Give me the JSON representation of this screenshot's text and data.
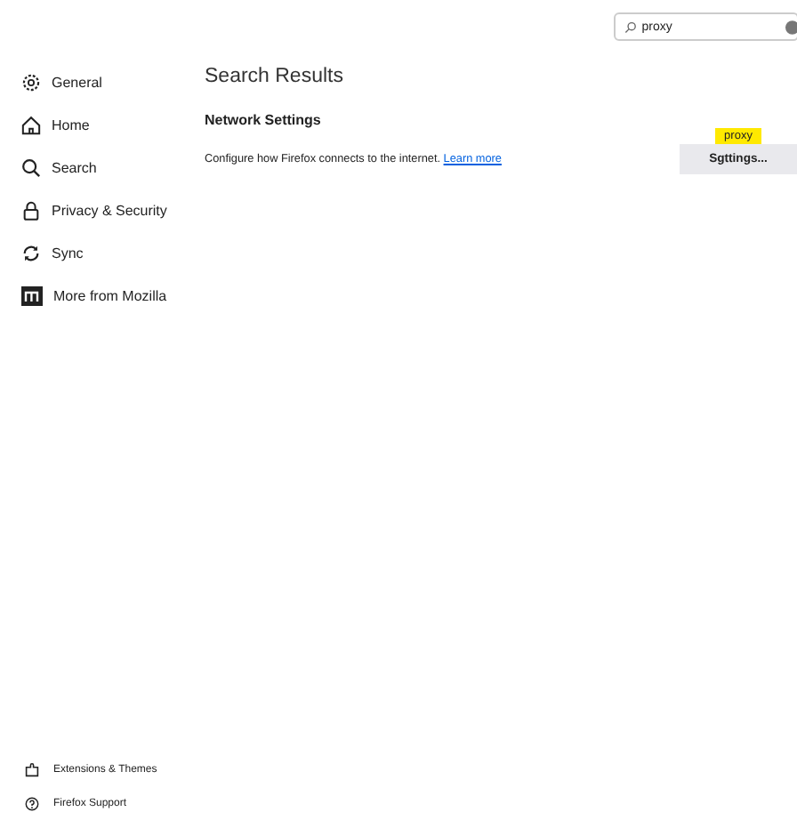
{
  "search": {
    "value": "proxy"
  },
  "sidebar": {
    "items": [
      {
        "label": "General"
      },
      {
        "label": "Home"
      },
      {
        "label": "Search"
      },
      {
        "label": "Privacy & Security"
      },
      {
        "label": "Sync"
      },
      {
        "label": "More from Mozilla"
      }
    ],
    "footer": [
      {
        "label": "Extensions & Themes"
      },
      {
        "label": "Firefox Support"
      }
    ]
  },
  "heading": "Search Results",
  "section": {
    "title": "Network Settings",
    "description": "Configure how Firefox connects to the internet.",
    "link": "Learn more",
    "button": "Sgttings...",
    "highlight": "proxy"
  }
}
